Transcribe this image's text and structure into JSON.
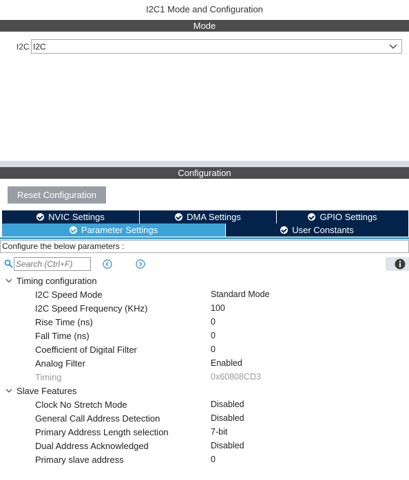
{
  "header": {
    "title": "I2C1 Mode and Configuration"
  },
  "mode": {
    "section_label": "Mode",
    "i2c_label": "I2C",
    "i2c_selected": "I2C"
  },
  "configuration": {
    "section_label": "Configuration",
    "reset_label": "Reset Configuration",
    "tabs": [
      {
        "label": "NVIC Settings",
        "active": false
      },
      {
        "label": "DMA Settings",
        "active": false
      },
      {
        "label": "GPIO Settings",
        "active": false
      },
      {
        "label": "Parameter Settings",
        "active": true
      },
      {
        "label": "User Constants",
        "active": false
      }
    ],
    "hint": "Configure the below parameters :",
    "search": {
      "placeholder": "Search (Ctrl+F)"
    },
    "groups": [
      {
        "label": "Timing configuration",
        "params": [
          {
            "name": "I2C Speed Mode",
            "value": "Standard Mode"
          },
          {
            "name": "I2C Speed Frequency (KHz)",
            "value": "100"
          },
          {
            "name": "Rise Time (ns)",
            "value": "0"
          },
          {
            "name": "Fall Time (ns)",
            "value": "0"
          },
          {
            "name": "Coefficient of Digital Filter",
            "value": "0"
          },
          {
            "name": "Analog Filter",
            "value": "Enabled"
          },
          {
            "name": "Timing",
            "value": "0x60808CD3"
          }
        ]
      },
      {
        "label": "Slave Features",
        "params": [
          {
            "name": "Clock No Stretch Mode",
            "value": "Disabled"
          },
          {
            "name": "General Call Address Detection",
            "value": "Disabled"
          },
          {
            "name": "Primary Address Length selection",
            "value": "7-bit"
          },
          {
            "name": "Dual Address Acknowledged",
            "value": "Disabled"
          },
          {
            "name": "Primary slave address",
            "value": "0"
          }
        ]
      }
    ]
  },
  "icons": {
    "check": "check-circle-icon",
    "search": "search-icon",
    "prev": "chevron-left-circle-icon",
    "next": "chevron-right-circle-icon",
    "info": "info-icon",
    "dropdown": "chevron-down-icon",
    "expand": "chevron-down-icon"
  },
  "colors": {
    "section_bar": "#4d4d4d",
    "tab_dark": "#03234b",
    "tab_active": "#3ba3d8",
    "reset_button": "#9a9ea4",
    "disabled_text": "#9a9a9a"
  }
}
